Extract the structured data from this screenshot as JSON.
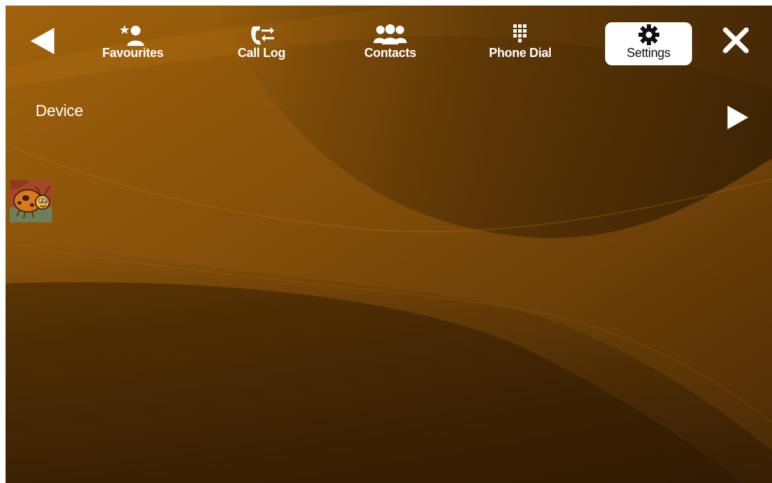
{
  "colors": {
    "background_primary": "#7a4a0a",
    "background_dark": "#3e2405",
    "text": "#ffffff",
    "active_tab_bg": "#ffffff",
    "active_tab_text": "#111111"
  },
  "nav": {
    "back_icon": "back-triangle-icon",
    "close_icon": "close-x-icon",
    "tabs": [
      {
        "label": "Favourites",
        "icon": "star-person-icon",
        "active": false
      },
      {
        "label": "Call Log",
        "icon": "phone-arrows-icon",
        "active": false
      },
      {
        "label": "Contacts",
        "icon": "people-group-icon",
        "active": false
      },
      {
        "label": "Phone Dial",
        "icon": "dialpad-icon",
        "active": false
      },
      {
        "label": "Settings",
        "icon": "gear-icon",
        "active": true
      }
    ]
  },
  "section": {
    "label": "Device",
    "forward_icon": "forward-triangle-icon"
  },
  "app_icon": {
    "icon": "ladybug-app-icon"
  }
}
